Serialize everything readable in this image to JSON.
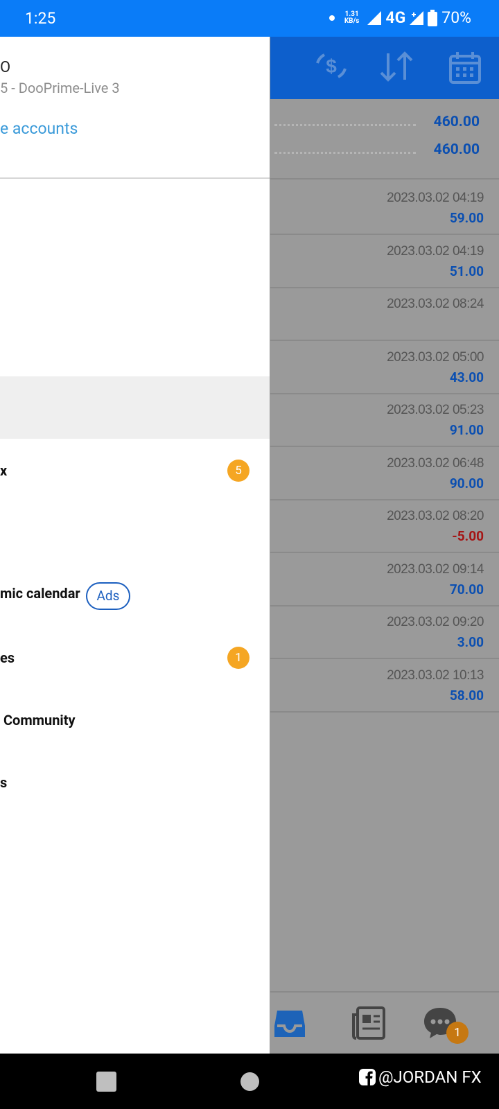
{
  "status_bar": {
    "time": "1:25",
    "net_speed_value": "1.31",
    "net_speed_unit": "KB/s",
    "network": "4G",
    "battery": "70%"
  },
  "drawer": {
    "account_name": "O",
    "account_server": "5 - DooPrime-Live 3",
    "manage_accounts": "e accounts",
    "menu": [
      {
        "label": "x",
        "badge": "5"
      },
      {
        "label": "mic calendar",
        "tag": "Ads"
      },
      {
        "label": "es",
        "badge": "1"
      },
      {
        "label": " Community"
      },
      {
        "label": "s"
      }
    ]
  },
  "summary": {
    "value1": "460.00",
    "value2": "460.00"
  },
  "trades": [
    {
      "date": "2023.03.02 04:19",
      "profit": "59.00"
    },
    {
      "date": "2023.03.02 04:19",
      "profit": "51.00"
    },
    {
      "date": "2023.03.02 08:24",
      "profit": ""
    },
    {
      "date": "2023.03.02 05:00",
      "profit": "43.00"
    },
    {
      "date": "2023.03.02 05:23",
      "profit": "91.00"
    },
    {
      "date": "2023.03.02 06:48",
      "profit": "90.00"
    },
    {
      "date": "2023.03.02 08:20",
      "profit": "-5.00"
    },
    {
      "date": "2023.03.02 09:14",
      "profit": "70.00"
    },
    {
      "date": "2023.03.02 09:20",
      "profit": "3.00"
    },
    {
      "date": "2023.03.02 10:13",
      "profit": "58.00"
    }
  ],
  "bottom_nav": {
    "chat_badge": "1"
  },
  "watermark": "@JORDAN FX",
  "colors": {
    "status_bar": "#0a7cf8",
    "toolbar": "#0d5fcc",
    "positive": "#0b4fb1",
    "negative": "#a51515",
    "badge": "#f5a623",
    "link": "#3a9ad9"
  }
}
